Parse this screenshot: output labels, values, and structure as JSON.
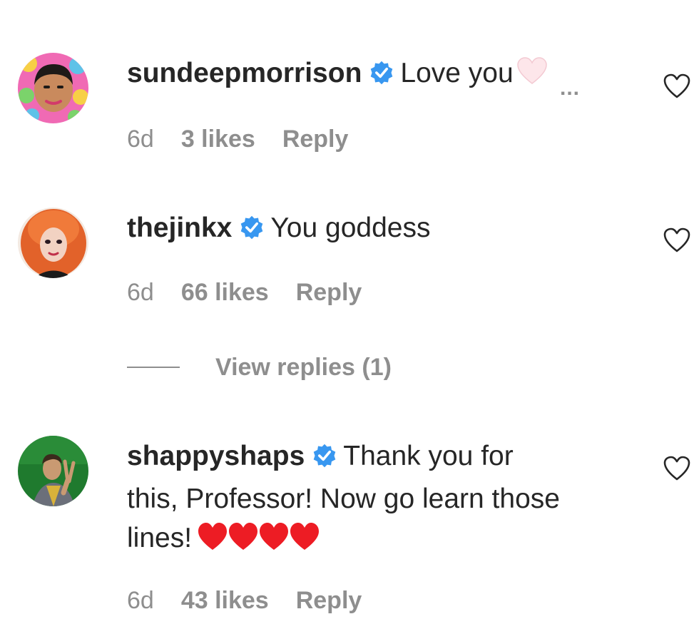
{
  "comments": [
    {
      "username": "sundeepmorrison",
      "verified": true,
      "text": "Love you",
      "truncated_emoji": "white-heart",
      "more_label": "...",
      "time": "6d",
      "likes": "3 likes",
      "reply": "Reply",
      "avatar_icon": "avatar-cartoon-face"
    },
    {
      "username": "thejinkx",
      "verified": true,
      "text": "You goddess",
      "time": "6d",
      "likes": "66 likes",
      "reply": "Reply",
      "avatar_icon": "avatar-red-hair-portrait",
      "view_replies": "View replies (1)"
    },
    {
      "username": "shappyshaps",
      "verified": true,
      "text_line1": "Thank you for",
      "text_line2": "this, Professor! Now go learn those",
      "text_line3": "lines!",
      "emojis": "red-heart x4",
      "time": "6d",
      "likes": "43 likes",
      "reply": "Reply",
      "avatar_icon": "avatar-peace-sign-portrait"
    }
  ],
  "colors": {
    "text": "#262626",
    "secondary": "#8e8e8e",
    "verified_blue": "#3897f0",
    "heart_red": "#ed1c24"
  }
}
